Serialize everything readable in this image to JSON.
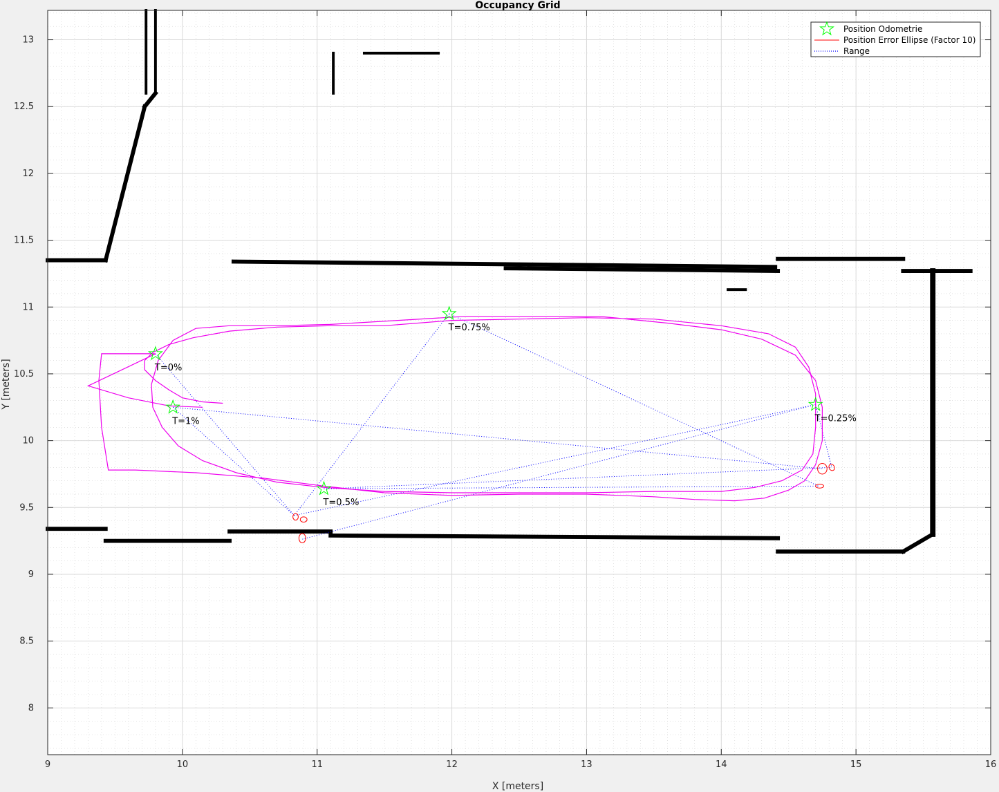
{
  "chart_data": {
    "type": "scatter",
    "title": "Occupancy Grid",
    "xlabel": "X [meters]",
    "ylabel": "Y [meters]",
    "xlim": [
      9,
      16
    ],
    "ylim": [
      7.65,
      13.22
    ],
    "xticks": [
      9,
      10,
      11,
      12,
      13,
      14,
      15,
      16
    ],
    "yticks": [
      8,
      8.5,
      9,
      9.5,
      10,
      10.5,
      11,
      11.5,
      12,
      12.5,
      13
    ],
    "grid": true,
    "minor_grid": true,
    "legend_position": "top-right",
    "legend": [
      {
        "label": "Position Odometrie",
        "marker": "star",
        "color": "#00ff00"
      },
      {
        "label": "Position Error Ellipse (Factor 10)",
        "marker": "line",
        "color": "#ff0000"
      },
      {
        "label": "Range",
        "marker": "dotted",
        "color": "#0000ff"
      }
    ],
    "odometry_positions": [
      {
        "label": "T=0%",
        "x": 9.8,
        "y": 10.65
      },
      {
        "label": "T=0.25%",
        "x": 14.7,
        "y": 10.27
      },
      {
        "label": "T=0.5%",
        "x": 11.05,
        "y": 9.64
      },
      {
        "label": "T=0.75%",
        "x": 11.98,
        "y": 10.95
      },
      {
        "label": "T=1%",
        "x": 9.93,
        "y": 10.25
      }
    ],
    "anchors": [
      {
        "x": 10.83,
        "y": 9.44
      },
      {
        "x": 10.88,
        "y": 9.26
      },
      {
        "x": 14.72,
        "y": 9.66
      },
      {
        "x": 14.75,
        "y": 9.79
      },
      {
        "x": 14.82,
        "y": 9.8
      }
    ],
    "ranges": [
      {
        "from": 0,
        "to": 0
      },
      {
        "from": 1,
        "to": 0
      },
      {
        "from": 1,
        "to": 1
      },
      {
        "from": 1,
        "to": 4
      },
      {
        "from": 2,
        "to": 2
      },
      {
        "from": 2,
        "to": 4
      },
      {
        "from": 3,
        "to": 0
      },
      {
        "from": 3,
        "to": 2
      },
      {
        "from": 4,
        "to": 0
      },
      {
        "from": 4,
        "to": 3
      }
    ],
    "error_ellipses": [
      {
        "x": 10.84,
        "y": 9.43,
        "rx": 0.02,
        "ry": 0.025,
        "angle": 0
      },
      {
        "x": 10.9,
        "y": 9.41,
        "rx": 0.025,
        "ry": 0.02,
        "angle": 0
      },
      {
        "x": 10.89,
        "y": 9.27,
        "rx": 0.025,
        "ry": 0.035,
        "angle": 0
      },
      {
        "x": 14.73,
        "y": 9.66,
        "rx": 0.03,
        "ry": 0.015,
        "angle": 0
      },
      {
        "x": 14.75,
        "y": 9.79,
        "rx": 0.035,
        "ry": 0.04,
        "angle": 0
      },
      {
        "x": 14.82,
        "y": 9.8,
        "rx": 0.02,
        "ry": 0.025,
        "angle": 30
      }
    ],
    "trajectory_x": [
      10.3,
      10.15,
      10.0,
      9.9,
      9.8,
      9.72,
      9.72,
      9.78,
      9.9,
      10.08,
      10.35,
      10.7,
      11.1,
      11.5,
      12.0,
      12.5,
      13.0,
      13.5,
      14.0,
      14.35,
      14.55,
      14.65,
      14.7,
      14.7,
      14.68,
      14.6,
      14.45,
      14.25,
      14.0,
      13.5,
      13.0,
      12.5,
      12.0,
      11.5,
      11.05,
      10.7,
      10.4,
      10.15,
      9.97,
      9.85,
      9.78,
      9.77,
      9.82,
      9.93,
      10.1,
      10.35,
      10.7,
      11.1,
      11.6,
      12.1,
      12.6,
      13.1,
      13.6,
      14.0,
      14.3,
      14.55,
      14.7,
      14.75,
      14.75,
      14.7,
      14.62,
      14.5,
      14.32,
      14.1,
      13.8,
      13.5,
      13.0,
      12.5,
      12.0,
      11.5,
      11.05,
      10.6,
      10.1,
      9.65,
      9.45,
      9.4,
      9.38,
      9.4,
      9.7,
      9.8,
      9.3,
      9.6,
      9.9,
      10.15
    ],
    "trajectory_y": [
      10.28,
      10.29,
      10.32,
      10.38,
      10.45,
      10.53,
      10.6,
      10.66,
      10.72,
      10.77,
      10.82,
      10.85,
      10.86,
      10.86,
      10.9,
      10.91,
      10.92,
      10.91,
      10.86,
      10.8,
      10.7,
      10.55,
      10.35,
      10.1,
      9.9,
      9.78,
      9.7,
      9.65,
      9.62,
      9.62,
      9.61,
      9.61,
      9.61,
      9.62,
      9.65,
      9.69,
      9.76,
      9.85,
      9.96,
      10.1,
      10.25,
      10.42,
      10.6,
      10.75,
      10.84,
      10.86,
      10.86,
      10.87,
      10.9,
      10.93,
      10.93,
      10.93,
      10.88,
      10.83,
      10.76,
      10.64,
      10.45,
      10.25,
      10.0,
      9.82,
      9.7,
      9.63,
      9.57,
      9.55,
      9.56,
      9.58,
      9.6,
      9.6,
      9.59,
      9.61,
      9.66,
      9.72,
      9.76,
      9.78,
      9.78,
      10.1,
      10.45,
      10.65,
      10.65,
      10.65,
      10.41,
      10.32,
      10.26,
      10.25
    ],
    "occupied_segments": [
      {
        "x1": 9.0,
        "y1": 11.35,
        "x2": 9.43,
        "y2": 11.35,
        "width": 0.03
      },
      {
        "x1": 9.43,
        "y1": 11.35,
        "x2": 9.72,
        "y2": 12.5,
        "width": 0.03
      },
      {
        "x1": 9.72,
        "y1": 12.5,
        "x2": 9.8,
        "y2": 12.6,
        "width": 0.03
      },
      {
        "x1": 9.73,
        "y1": 12.6,
        "x2": 9.73,
        "y2": 13.22,
        "width": 0.02
      },
      {
        "x1": 9.8,
        "y1": 12.6,
        "x2": 9.8,
        "y2": 13.22,
        "width": 0.02
      },
      {
        "x1": 10.38,
        "y1": 11.34,
        "x2": 14.4,
        "y2": 11.3,
        "width": 0.03
      },
      {
        "x1": 12.4,
        "y1": 11.29,
        "x2": 14.42,
        "y2": 11.27,
        "width": 0.03
      },
      {
        "x1": 14.42,
        "y1": 11.36,
        "x2": 15.35,
        "y2": 11.36,
        "width": 0.03
      },
      {
        "x1": 15.35,
        "y1": 11.27,
        "x2": 15.85,
        "y2": 11.27,
        "width": 0.03
      },
      {
        "x1": 15.57,
        "y1": 11.27,
        "x2": 15.57,
        "y2": 9.3,
        "width": 0.04
      },
      {
        "x1": 15.57,
        "y1": 9.3,
        "x2": 15.35,
        "y2": 9.17,
        "width": 0.03
      },
      {
        "x1": 14.42,
        "y1": 9.17,
        "x2": 15.35,
        "y2": 9.17,
        "width": 0.03
      },
      {
        "x1": 11.1,
        "y1": 9.29,
        "x2": 14.42,
        "y2": 9.27,
        "width": 0.03
      },
      {
        "x1": 10.35,
        "y1": 9.32,
        "x2": 11.1,
        "y2": 9.32,
        "width": 0.03
      },
      {
        "x1": 9.43,
        "y1": 9.25,
        "x2": 10.35,
        "y2": 9.25,
        "width": 0.03
      },
      {
        "x1": 9.0,
        "y1": 9.34,
        "x2": 9.43,
        "y2": 9.34,
        "width": 0.03
      },
      {
        "x1": 11.12,
        "y1": 12.6,
        "x2": 11.12,
        "y2": 12.9,
        "width": 0.02
      },
      {
        "x1": 11.35,
        "y1": 12.9,
        "x2": 11.9,
        "y2": 12.9,
        "width": 0.02
      },
      {
        "x1": 14.05,
        "y1": 11.13,
        "x2": 14.18,
        "y2": 11.13,
        "width": 0.02
      }
    ]
  }
}
